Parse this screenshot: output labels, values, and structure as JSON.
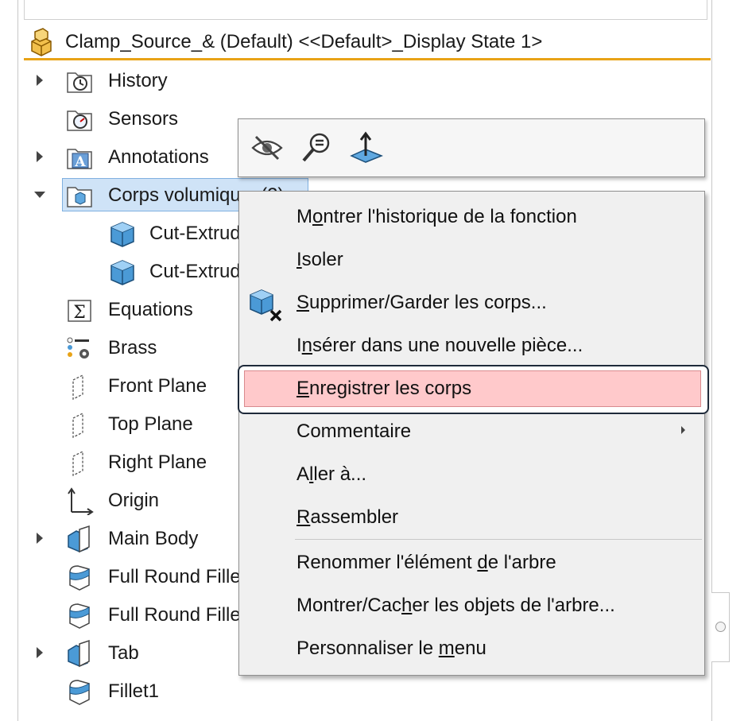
{
  "header": {
    "title": "Clamp_Source_& (Default) <<Default>_Display State 1>"
  },
  "tree": {
    "items": [
      {
        "label": "History",
        "icon": "history-icon",
        "expander": "collapsed"
      },
      {
        "label": "Sensors",
        "icon": "sensors-icon",
        "expander": "none"
      },
      {
        "label": "Annotations",
        "icon": "annotations-icon",
        "expander": "collapsed"
      },
      {
        "label": "Corps volumiques(2)",
        "icon": "solid-bodies-folder-icon",
        "expander": "expanded",
        "selected": true
      },
      {
        "label": "Cut-Extrude",
        "icon": "solid-body-icon",
        "indent": true
      },
      {
        "label": "Cut-Extrude",
        "icon": "solid-body-icon",
        "indent": true
      },
      {
        "label": "Equations",
        "icon": "equations-icon",
        "expander": "none"
      },
      {
        "label": "Brass",
        "icon": "material-icon",
        "expander": "none"
      },
      {
        "label": "Front Plane",
        "icon": "plane-icon",
        "expander": "none"
      },
      {
        "label": "Top Plane",
        "icon": "plane-icon",
        "expander": "none"
      },
      {
        "label": "Right Plane",
        "icon": "plane-icon",
        "expander": "none"
      },
      {
        "label": "Origin",
        "icon": "origin-icon",
        "expander": "none"
      },
      {
        "label": "Main Body",
        "icon": "extrude-feature-icon",
        "expander": "collapsed"
      },
      {
        "label": "Full Round Fillet",
        "icon": "fillet-feature-icon",
        "expander": "none"
      },
      {
        "label": "Full Round Fillet",
        "icon": "fillet-feature-icon",
        "expander": "none"
      },
      {
        "label": "Tab",
        "icon": "extrude-feature-icon",
        "expander": "collapsed"
      },
      {
        "label": "Fillet1",
        "icon": "fillet-feature-icon",
        "expander": "none"
      }
    ]
  },
  "mini_toolbar": {
    "buttons": [
      {
        "name": "hide-icon"
      },
      {
        "name": "zoom-to-selection-icon"
      },
      {
        "name": "normal-to-icon"
      }
    ]
  },
  "context_menu": {
    "items": [
      {
        "pre": "M",
        "u": "o",
        "post": "ntrer l'historique de la fonction"
      },
      {
        "pre": "",
        "u": "I",
        "post": "soler"
      },
      {
        "pre": "",
        "u": "S",
        "post": "upprimer/Garder les corps...",
        "icon": "delete-keep-body-icon"
      },
      {
        "pre": "I",
        "u": "n",
        "post": "sérer dans une nouvelle pièce..."
      },
      {
        "pre": "",
        "u": "E",
        "post": "nregistrer les corps",
        "highlighted": true
      },
      {
        "pre": "Commentaire",
        "u": "",
        "post": "",
        "submenu": true
      },
      {
        "pre": "A",
        "u": "l",
        "post": "ler à..."
      },
      {
        "pre": "",
        "u": "R",
        "post": "assembler"
      },
      {
        "pre": "Renommer l'élément ",
        "u": "d",
        "post": "e l'arbre"
      },
      {
        "pre": "Montrer/Cac",
        "u": "h",
        "post": "er les objets de l'arbre..."
      },
      {
        "pre": "Personnaliser le ",
        "u": "m",
        "post": "enu"
      }
    ]
  },
  "colors": {
    "accent_line": "#e8a317",
    "selection": "#cfe3f7",
    "highlight": "#ffc9cb",
    "menu_bg": "#f0f0f0"
  }
}
